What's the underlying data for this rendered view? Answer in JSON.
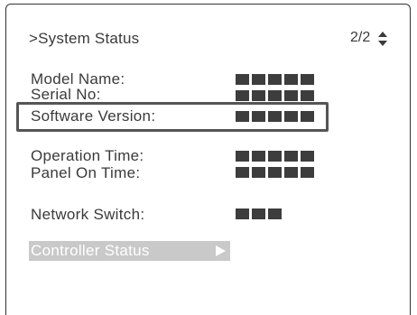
{
  "header": {
    "title": ">System Status",
    "page_indicator": "2/2"
  },
  "rows": [
    {
      "label": "Model Name:",
      "value_blocks": 5
    },
    {
      "label": "Serial No:",
      "value_blocks": 5
    },
    {
      "label": "Software Version:",
      "value_blocks": 5
    },
    {
      "label": "Operation Time:",
      "value_blocks": 5
    },
    {
      "label": "Panel On Time:",
      "value_blocks": 5
    },
    {
      "label": "Network Switch:",
      "value_blocks": 3
    }
  ],
  "menu": {
    "controller_status_label": "Controller Status"
  }
}
